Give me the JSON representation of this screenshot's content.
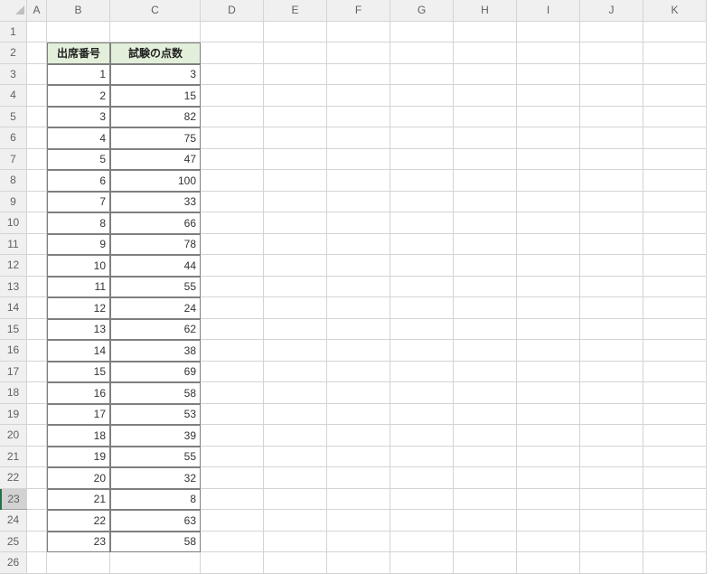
{
  "columns": [
    "A",
    "B",
    "C",
    "D",
    "E",
    "F",
    "G",
    "H",
    "I",
    "J",
    "K"
  ],
  "rowsVisible": 26,
  "selectedRow": 23,
  "table": {
    "startRow": 2,
    "colB": "B",
    "colC": "C",
    "headers": {
      "b": "出席番号",
      "c": "試験の点数"
    },
    "rows": [
      {
        "b": "1",
        "c": "3"
      },
      {
        "b": "2",
        "c": "15"
      },
      {
        "b": "3",
        "c": "82"
      },
      {
        "b": "4",
        "c": "75"
      },
      {
        "b": "5",
        "c": "47"
      },
      {
        "b": "6",
        "c": "100"
      },
      {
        "b": "7",
        "c": "33"
      },
      {
        "b": "8",
        "c": "66"
      },
      {
        "b": "9",
        "c": "78"
      },
      {
        "b": "10",
        "c": "44"
      },
      {
        "b": "11",
        "c": "55"
      },
      {
        "b": "12",
        "c": "24"
      },
      {
        "b": "13",
        "c": "62"
      },
      {
        "b": "14",
        "c": "38"
      },
      {
        "b": "15",
        "c": "69"
      },
      {
        "b": "16",
        "c": "58"
      },
      {
        "b": "17",
        "c": "53"
      },
      {
        "b": "18",
        "c": "39"
      },
      {
        "b": "19",
        "c": "55"
      },
      {
        "b": "20",
        "c": "32"
      },
      {
        "b": "21",
        "c": "8"
      },
      {
        "b": "22",
        "c": "63"
      },
      {
        "b": "23",
        "c": "58"
      }
    ]
  }
}
